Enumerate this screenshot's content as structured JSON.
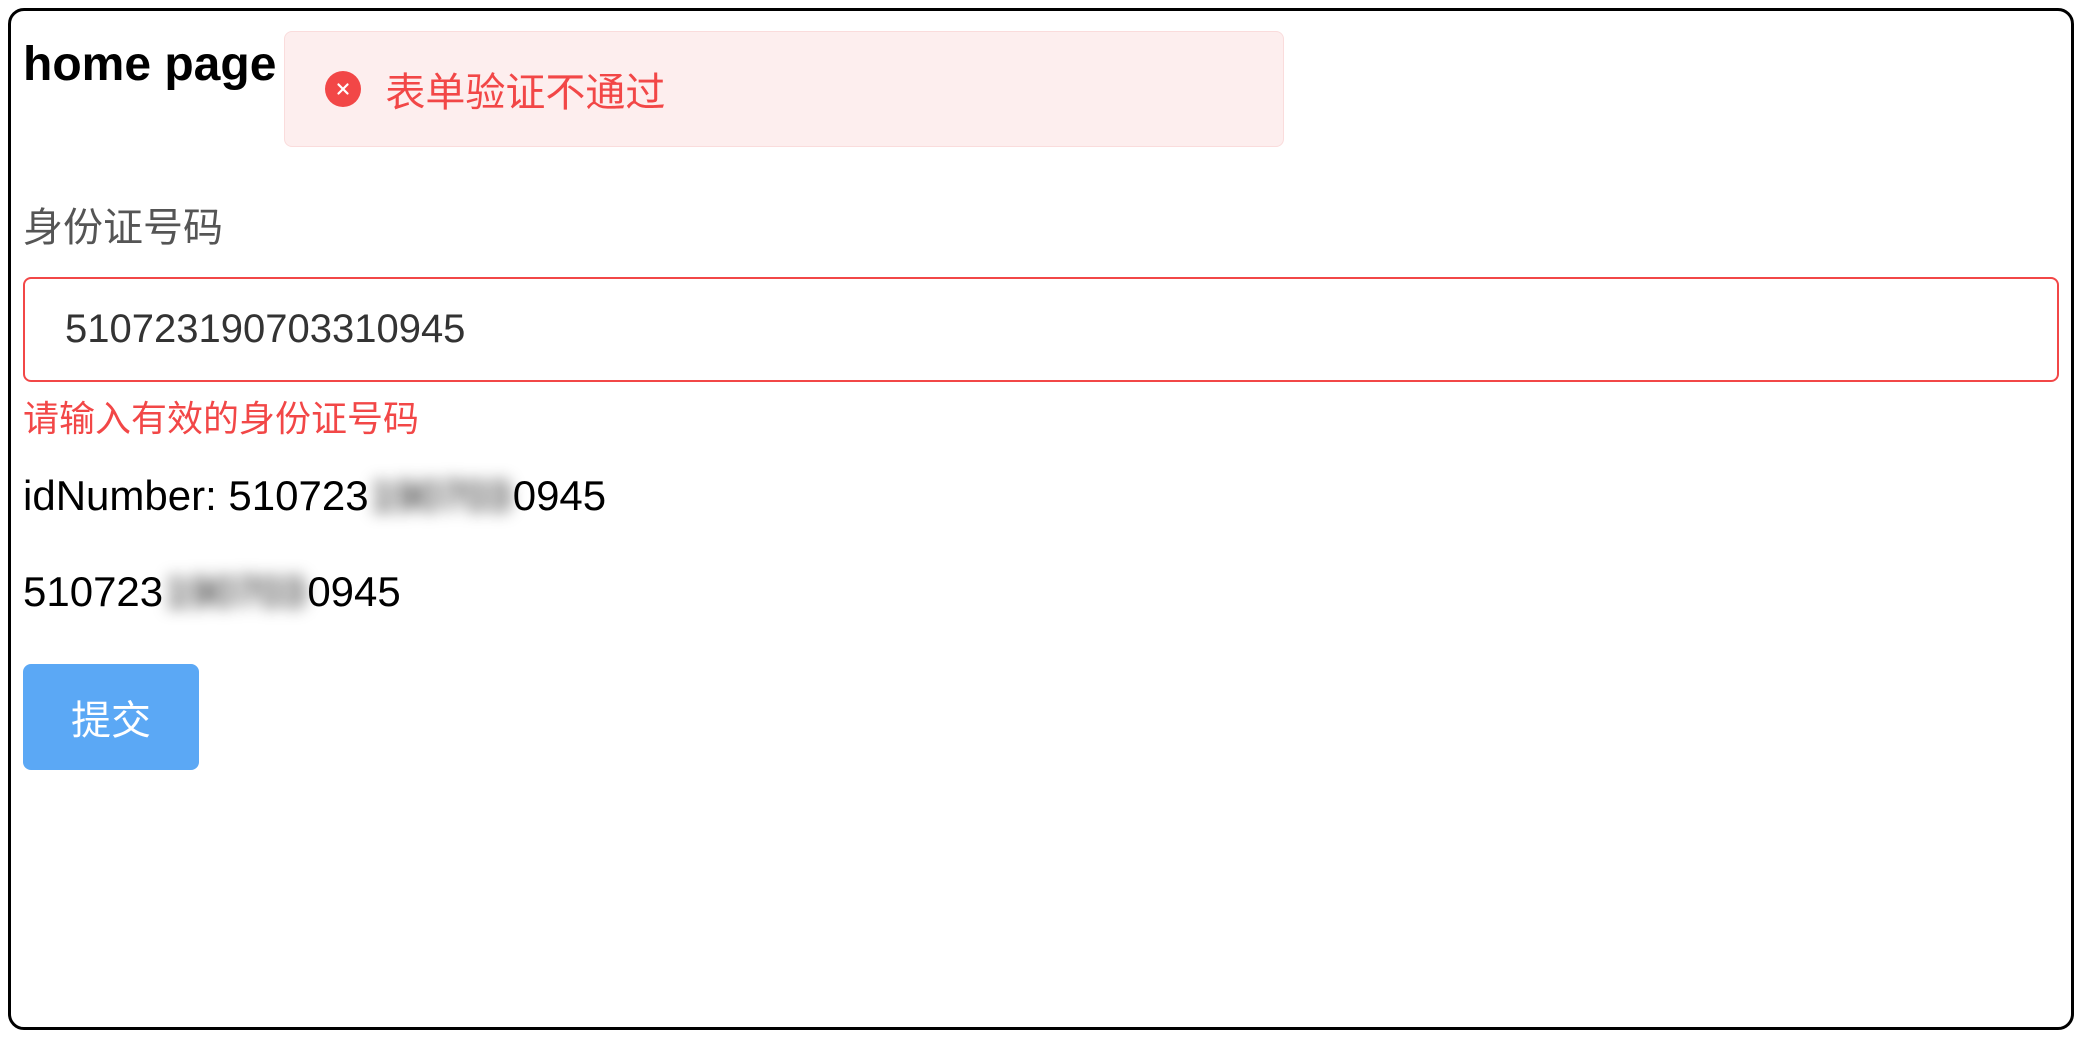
{
  "header": {
    "title": "home page"
  },
  "alert": {
    "message": "表单验证不通过"
  },
  "form": {
    "idLabel": "身份证号码",
    "idValue": "510723190703310945",
    "errorMsg": "请输入有效的身份证号码"
  },
  "display": {
    "line1_prefix": "idNumber: 510723",
    "line1_blurred": "190703",
    "line1_suffix": "0945",
    "line2_prefix": "510723",
    "line2_blurred": "190703",
    "line2_suffix": "0945"
  },
  "actions": {
    "submitLabel": "提交"
  }
}
